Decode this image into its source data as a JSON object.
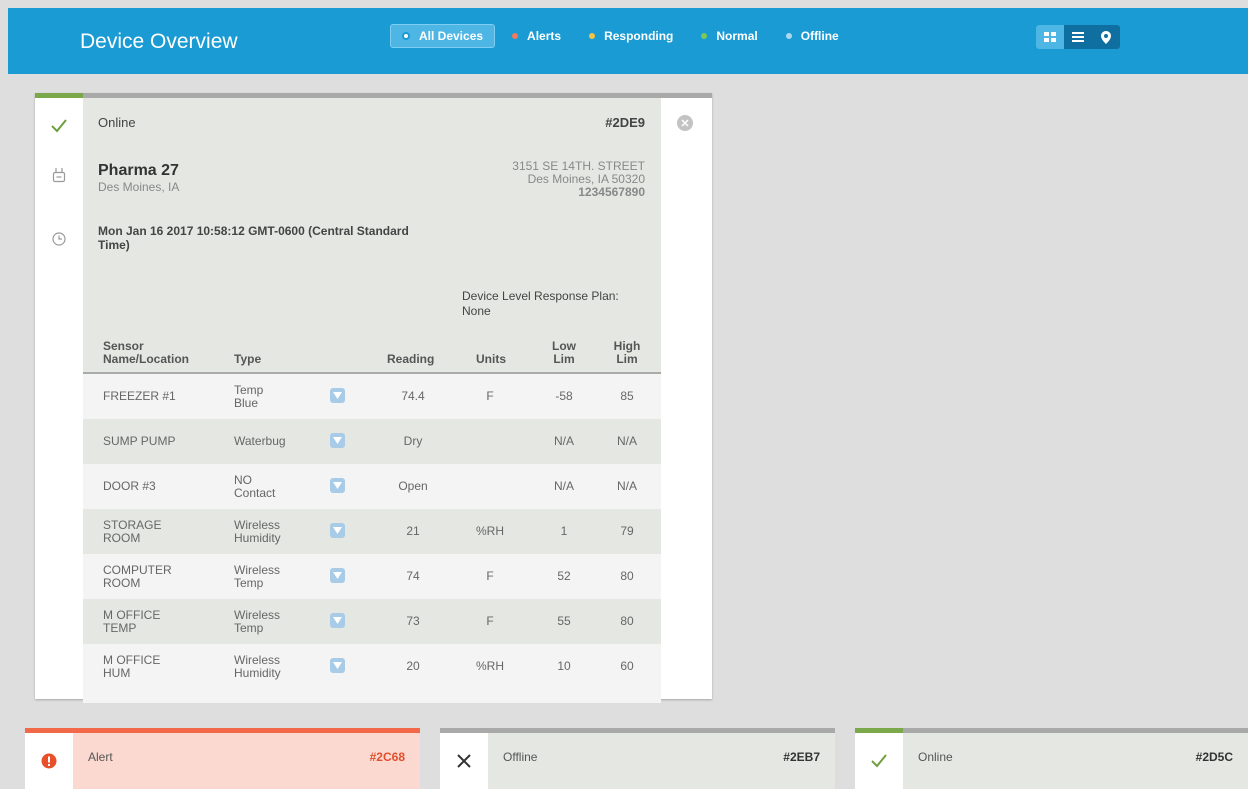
{
  "header": {
    "title": "Device Overview",
    "filters": [
      {
        "label": "All Devices",
        "dot_color": "#ffffff",
        "active": true
      },
      {
        "label": "Alerts",
        "dot_color": "#f07a5a",
        "active": false
      },
      {
        "label": "Responding",
        "dot_color": "#f5c342",
        "active": false
      },
      {
        "label": "Normal",
        "dot_color": "#7ec85a",
        "active": false
      },
      {
        "label": "Offline",
        "dot_color": "#aed8ee",
        "active": false
      }
    ],
    "view_modes": [
      "grid-icon",
      "list-icon",
      "map-pin-icon"
    ],
    "active_view": "grid-icon"
  },
  "device": {
    "status": "Online",
    "id": "#2DE9",
    "name": "Pharma 27",
    "city": "Des Moines, IA",
    "address_line1": "3151 SE 14TH. STREET",
    "address_line2": "Des Moines, IA 50320",
    "phone": "1234567890",
    "timestamp": "Mon Jan 16 2017 10:58:12 GMT-0600 (Central Standard Time)",
    "response_plan_label": "Device Level Response Plan:",
    "response_plan_value": "None",
    "side_icons": [
      "check-icon",
      "device-icon",
      "clock-icon"
    ],
    "status_color": "#7aa84a",
    "table": {
      "headers": {
        "sensor_line1": "Sensor",
        "sensor_line2": "Name/Location",
        "type": "Type",
        "reading": "Reading",
        "units": "Units",
        "low_line1": "Low",
        "low_line2": "Lim",
        "high_line1": "High",
        "high_line2": "Lim"
      },
      "rows": [
        {
          "name1": "FREEZER #1",
          "name2": "",
          "type1": "Temp",
          "type2": "Blue",
          "reading": "74.4",
          "units": "F",
          "low": "-58",
          "high": "85"
        },
        {
          "name1": "SUMP PUMP",
          "name2": "",
          "type1": "Waterbug",
          "type2": "",
          "reading": "Dry",
          "units": "",
          "low": "N/A",
          "high": "N/A"
        },
        {
          "name1": "DOOR #3",
          "name2": "",
          "type1": "NO",
          "type2": "Contact",
          "reading": "Open",
          "units": "",
          "low": "N/A",
          "high": "N/A"
        },
        {
          "name1": "STORAGE",
          "name2": "ROOM",
          "type1": "Wireless",
          "type2": "Humidity",
          "reading": "21",
          "units": "%RH",
          "low": "1",
          "high": "79"
        },
        {
          "name1": "COMPUTER",
          "name2": "ROOM",
          "type1": "Wireless",
          "type2": "Temp",
          "reading": "74",
          "units": "F",
          "low": "52",
          "high": "80"
        },
        {
          "name1": "M OFFICE",
          "name2": "TEMP",
          "type1": "Wireless",
          "type2": "Temp",
          "reading": "73",
          "units": "F",
          "low": "55",
          "high": "80"
        },
        {
          "name1": "M OFFICE",
          "name2": "HUM",
          "type1": "Wireless",
          "type2": "Humidity",
          "reading": "20",
          "units": "%RH",
          "low": "10",
          "high": "60"
        }
      ]
    }
  },
  "bottom_cards": [
    {
      "status": "Alert",
      "id": "#2C68",
      "icon": "alert-icon",
      "accent": "#f2694a",
      "body_color": "#fcd9d0",
      "text_color": "#555",
      "id_color": "#e0502e"
    },
    {
      "status": "Offline",
      "id": "#2EB7",
      "icon": "x-icon",
      "accent": "#a9a9a9",
      "body_color": "#e5e8e2",
      "text_color": "#555",
      "id_color": "#333"
    },
    {
      "status": "Online",
      "id": "#2D5C",
      "icon": "check-icon",
      "accent": "#a9a9a9",
      "body_color": "#e5e8e2",
      "text_color": "#555",
      "id_color": "#333"
    }
  ]
}
